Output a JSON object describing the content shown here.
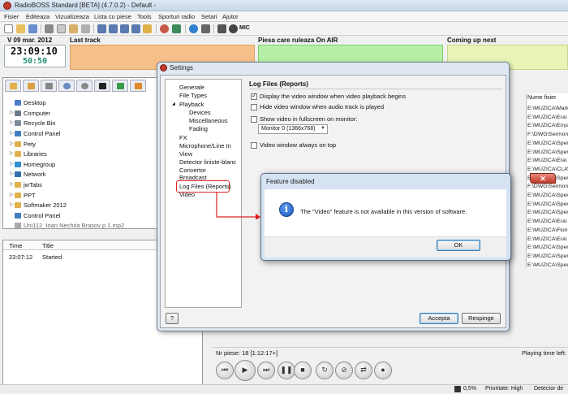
{
  "window": {
    "title": "RadioBOSS Standard [BETA] (4.7.0.2) - Default -"
  },
  "menu": [
    "Fisier",
    "Editeaza",
    "Vizualizeaza",
    "Lista cu piese",
    "Tools",
    "Sporturi radio",
    "Setari",
    "Ajutor"
  ],
  "toolbar": {
    "mic_label": "MIC"
  },
  "header": {
    "date": "V 09 mar. 2012",
    "time": "23:09:10",
    "remaining": "50:50",
    "last_track_label": "Last track",
    "on_air_label": "Piesa care ruleaza On AIR",
    "coming_up_label": "Coming up next"
  },
  "file_tree": [
    {
      "label": "Desktop",
      "color": "#4a7cc9",
      "expand": ""
    },
    {
      "label": "Computer",
      "color": "#6b7b8c",
      "expand": "▷"
    },
    {
      "label": "Recycle Bin",
      "color": "#7a8a99",
      "expand": "▷"
    },
    {
      "label": "Control Panel",
      "color": "#3f7fbf",
      "expand": "▷"
    },
    {
      "label": "Pety",
      "color": "#e0b04a",
      "expand": "▷"
    },
    {
      "label": "Libraries",
      "color": "#e0b04a",
      "expand": "▷"
    },
    {
      "label": "Homegroup",
      "color": "#2f8fd0",
      "expand": "▷"
    },
    {
      "label": "Network",
      "color": "#2f6fb0",
      "expand": "▷"
    },
    {
      "label": "jwTabs",
      "color": "#e0b04a",
      "expand": "▷"
    },
    {
      "label": "PPT",
      "color": "#e0b04a",
      "expand": "▷"
    },
    {
      "label": "Softmaker 2012",
      "color": "#e0b04a",
      "expand": "▷"
    },
    {
      "label": "Control Panel",
      "color": "#3f7fbf",
      "expand": ""
    },
    {
      "label": "Uni112_Ioan Nechita Brasov p 1.mp2",
      "color": "#aaaaaa",
      "expand": ""
    }
  ],
  "log": {
    "col_time": "Time",
    "col_title": "Title",
    "rows": [
      {
        "time": "23:07:12",
        "title": "Started"
      }
    ]
  },
  "playlist": {
    "col_filename": "Nume fisier",
    "rows": [
      "E:\\MUZICA\\Mark",
      "E:\\MUZICA\\Era\\",
      "E:\\MUZICA\\Enya",
      "F:\\DWG\\Sermon",
      "E:\\MUZICA\\Sper",
      "E:\\MUZICA\\Sper",
      "E:\\MUZICA\\Era\\",
      "E:\\MUZICA\\CLAV",
      "E:\\MUZICA\\Sper",
      "F:\\DWG\\Sermon",
      "E:\\MUZICA\\Sper",
      "E:\\MUZICA\\Sper",
      "E:\\MUZICA\\Sper",
      "E:\\MUZICA\\Era\\",
      "E:\\MUZICA\\Flori",
      "E:\\MUZICA\\Era\\",
      "E:\\MUZICA\\Sper",
      "E:\\MUZICA\\Sper",
      "E:\\MUZICA\\Sper"
    ]
  },
  "status": {
    "tracks": "Nr piese: 18 [1:12:17+]",
    "playing_left": "Playing time left:",
    "cpu": "0,5%",
    "priority": "Prioritate: High",
    "detector": "Detector de"
  },
  "settings": {
    "title": "Settings",
    "nav": [
      {
        "label": "Generale",
        "level": 0
      },
      {
        "label": "File Types",
        "level": 0
      },
      {
        "label": "Playback",
        "level": 0,
        "expand": "◢"
      },
      {
        "label": "Devices",
        "level": 1
      },
      {
        "label": "Miscellaneous",
        "level": 1
      },
      {
        "label": "Fading",
        "level": 1
      },
      {
        "label": "FX",
        "level": 0
      },
      {
        "label": "Microphone/Line In",
        "level": 0
      },
      {
        "label": "View",
        "level": 0
      },
      {
        "label": "Detector liniste-blanc",
        "level": 0
      },
      {
        "label": "Convertor",
        "level": 0
      },
      {
        "label": "Broadcast",
        "level": 0
      },
      {
        "label": "Log Files (Reports)",
        "level": 0
      },
      {
        "label": "Video",
        "level": 0
      }
    ],
    "section_title": "Log Files (Reports)",
    "options": [
      {
        "label": "Display the video window when video playback begins",
        "checked": true
      },
      {
        "label": "Hide video window when audio track is played",
        "checked": false
      },
      {
        "label": "Show video in fullscreen on monitor:",
        "checked": false
      }
    ],
    "monitor_select": "Monitor 0 (1366x768)",
    "always_on_top": "Video window always on top",
    "help_label": "?",
    "ok_label": "Accepta",
    "cancel_label": "Respinge"
  },
  "dialog": {
    "title": "Feature disabled",
    "close_label": "✕",
    "icon_glyph": "i",
    "message": "The \"Video\" feature is not available in this version of software.",
    "ok_label": "OK"
  },
  "colors": {
    "last_track": "#f6c08a",
    "on_air": "#b5f0a6",
    "coming_up": "#e9f4b6",
    "annotation_red": "#e02020"
  }
}
